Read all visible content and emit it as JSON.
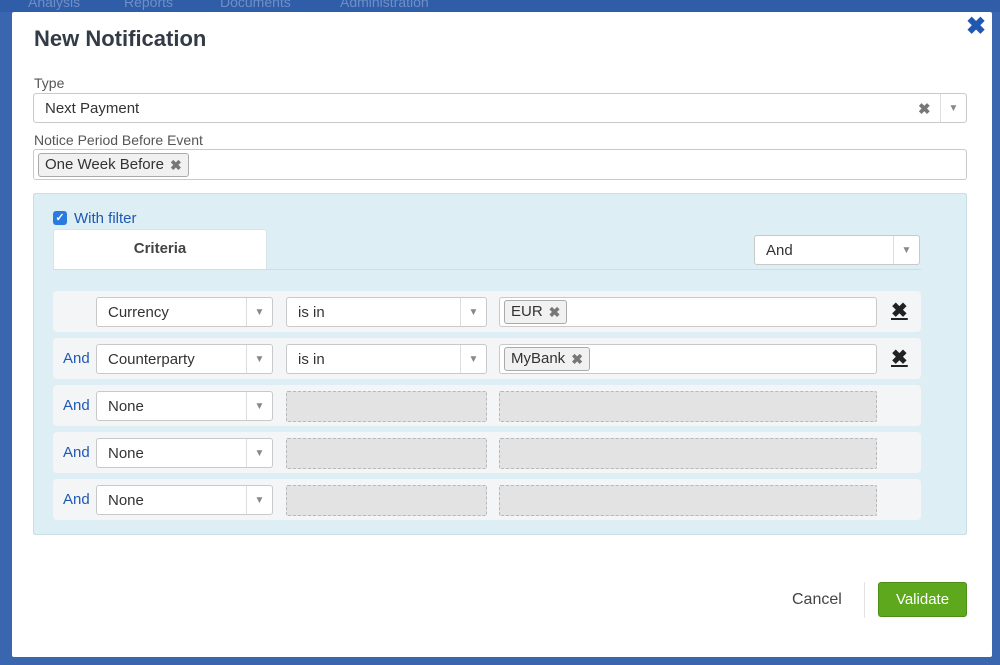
{
  "background_nav": {
    "items": [
      "Analysis",
      "Reports",
      "Documents",
      "Administration"
    ]
  },
  "dialog": {
    "title": "New Notification",
    "close_icon": "close-icon",
    "type": {
      "label": "Type",
      "value": "Next Payment"
    },
    "notice_period": {
      "label": "Notice Period Before Event",
      "tags": [
        "One Week Before"
      ]
    },
    "filter": {
      "checkbox_label": "With filter",
      "checked": true,
      "tab_label": "Criteria",
      "combinator": "And",
      "rows": [
        {
          "prefix": "",
          "field": "Currency",
          "operator": "is in",
          "values": [
            "EUR"
          ],
          "removable": true
        },
        {
          "prefix": "And",
          "field": "Counterparty",
          "operator": "is in",
          "values": [
            "MyBank"
          ],
          "removable": true
        },
        {
          "prefix": "And",
          "field": "None",
          "operator": "",
          "values": [],
          "removable": false
        },
        {
          "prefix": "And",
          "field": "None",
          "operator": "",
          "values": [],
          "removable": false
        },
        {
          "prefix": "And",
          "field": "None",
          "operator": "",
          "values": [],
          "removable": false
        }
      ]
    },
    "footer": {
      "cancel_label": "Cancel",
      "validate_label": "Validate"
    }
  },
  "colors": {
    "accent": "#1f58b2",
    "validate": "#5ea81d",
    "panel": "#ddeef4"
  }
}
